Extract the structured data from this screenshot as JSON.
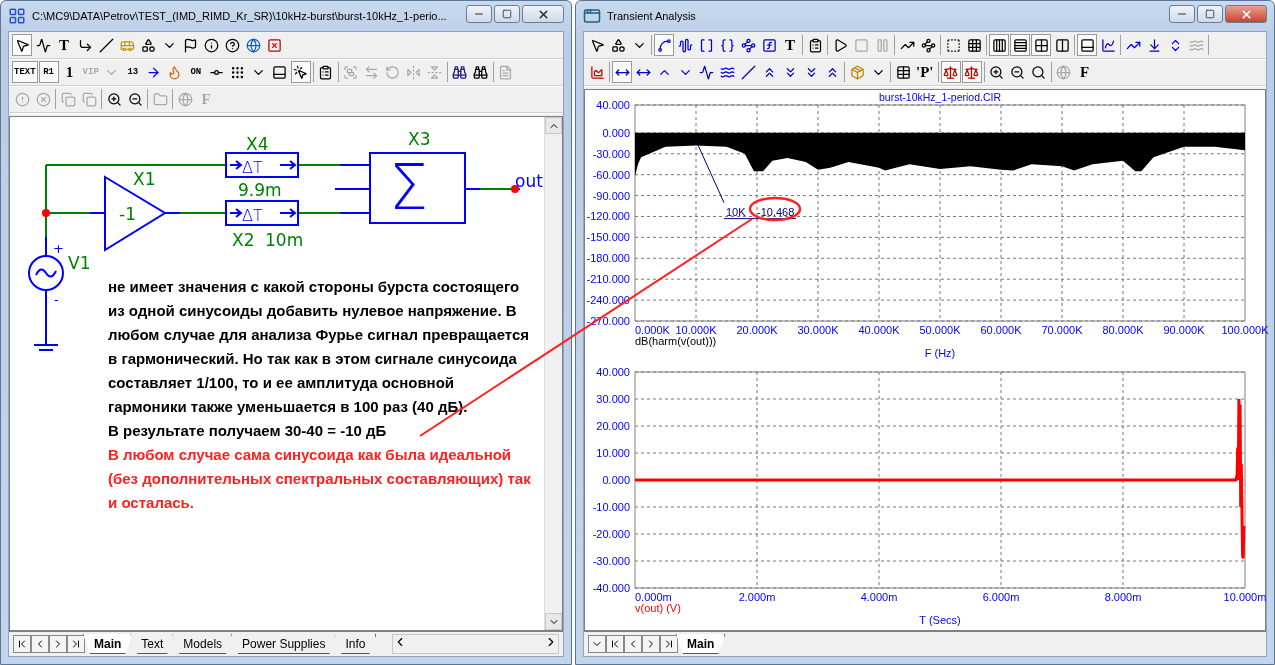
{
  "schematic_window": {
    "title": "C:\\MC9\\DATA\\Petrov\\TEST_(IMD_RIMD_Kr_SR)\\10kHz-burst\\burst-10kHz_1-perio...",
    "active": false,
    "toolbars": [
      [
        {
          "kind": "icon",
          "selected": true,
          "disabled": false
        },
        {
          "kind": "icon",
          "selected": false,
          "disabled": false
        },
        {
          "kind": "text",
          "label": "T",
          "selected": false,
          "disabled": false
        },
        {
          "kind": "icon",
          "selected": false,
          "disabled": false
        },
        {
          "kind": "icon",
          "selected": false,
          "disabled": false
        },
        {
          "kind": "icon",
          "selected": false,
          "disabled": false
        },
        {
          "kind": "icon",
          "selected": false,
          "disabled": false
        },
        {
          "kind": "icon",
          "selected": false,
          "disabled": false
        },
        {
          "kind": "icon",
          "selected": false,
          "disabled": false
        },
        {
          "kind": "icon",
          "selected": false,
          "disabled": false
        },
        {
          "kind": "icon",
          "selected": false,
          "disabled": false
        },
        {
          "kind": "icon",
          "selected": false,
          "disabled": false
        },
        {
          "kind": "icon",
          "selected": false,
          "disabled": false
        }
      ],
      [
        {
          "kind": "text",
          "label": "TEXT",
          "selected": true,
          "disabled": false
        },
        {
          "kind": "text",
          "label": "R1",
          "selected": true,
          "disabled": false
        },
        {
          "kind": "text",
          "label": "1",
          "selected": false,
          "disabled": false
        },
        {
          "kind": "text",
          "label": "VIP",
          "selected": false,
          "disabled": true
        },
        {
          "kind": "icon",
          "selected": false,
          "disabled": true
        },
        {
          "kind": "text",
          "label": "13",
          "selected": false,
          "disabled": false
        },
        {
          "kind": "icon",
          "selected": false,
          "disabled": false
        },
        {
          "kind": "icon",
          "selected": false,
          "disabled": false
        },
        {
          "kind": "text",
          "label": "ON",
          "selected": false,
          "disabled": false
        },
        {
          "kind": "icon",
          "selected": false,
          "disabled": false
        },
        {
          "kind": "icon",
          "selected": false,
          "disabled": false
        },
        {
          "kind": "icon",
          "selected": false,
          "disabled": false
        },
        {
          "kind": "icon",
          "selected": false,
          "disabled": false
        },
        {
          "kind": "icon",
          "selected": true,
          "disabled": false
        },
        {
          "kind": "separator"
        },
        {
          "kind": "icon",
          "selected": false,
          "disabled": false
        },
        {
          "kind": "separator"
        },
        {
          "kind": "icon",
          "selected": false,
          "disabled": true
        },
        {
          "kind": "icon",
          "selected": false,
          "disabled": true
        },
        {
          "kind": "icon",
          "selected": false,
          "disabled": true
        },
        {
          "kind": "icon",
          "selected": false,
          "disabled": true
        },
        {
          "kind": "icon",
          "selected": false,
          "disabled": true
        },
        {
          "kind": "separator"
        },
        {
          "kind": "icon",
          "selected": false,
          "disabled": false
        },
        {
          "kind": "icon",
          "selected": false,
          "disabled": false
        },
        {
          "kind": "separator"
        },
        {
          "kind": "icon",
          "selected": false,
          "disabled": true
        }
      ],
      [
        {
          "kind": "icon",
          "selected": false,
          "disabled": true
        },
        {
          "kind": "icon",
          "selected": false,
          "disabled": true
        },
        {
          "kind": "separator"
        },
        {
          "kind": "icon",
          "selected": false,
          "disabled": true
        },
        {
          "kind": "icon",
          "selected": false,
          "disabled": true
        },
        {
          "kind": "separator"
        },
        {
          "kind": "icon",
          "selected": false,
          "disabled": false
        },
        {
          "kind": "icon",
          "selected": false,
          "disabled": false
        },
        {
          "kind": "separator"
        },
        {
          "kind": "icon",
          "selected": false,
          "disabled": true
        },
        {
          "kind": "separator"
        },
        {
          "kind": "icon",
          "selected": false,
          "disabled": true
        },
        {
          "kind": "text",
          "label": "F",
          "selected": false,
          "disabled": true
        }
      ]
    ],
    "schematic": {
      "labels": [
        {
          "kind": "component",
          "text": "X4"
        },
        {
          "kind": "component",
          "text": "9.9m"
        },
        {
          "kind": "component",
          "text": "X1"
        },
        {
          "kind": "component",
          "text": "-1"
        },
        {
          "kind": "component",
          "text": "X2"
        },
        {
          "kind": "component",
          "text": "10m"
        },
        {
          "kind": "component",
          "text": "X3"
        },
        {
          "kind": "node",
          "text": "out"
        },
        {
          "kind": "component",
          "text": "V1"
        },
        {
          "kind": "pin",
          "text": "+"
        },
        {
          "kind": "pin",
          "text": "-"
        },
        {
          "kind": "symbol",
          "text": "ΔT"
        },
        {
          "kind": "symbol",
          "text": "ΔT"
        },
        {
          "kind": "symbol",
          "text": "Σ"
        }
      ]
    },
    "notes": [
      {
        "kind": "plain",
        "text": "не имеет значения с какой стороны бурста состоящего из одной синусоиды добавить нулевое напряжение. В любом случае для анализа Фурье сигнал превращается в гармонический. Но так как в этом сигнале синусоида составляет 1/100, то и ее амплитуда основной гармоники также уменьшается в 100 раз (40 дБ)."
      },
      {
        "kind": "plain",
        "text": "В результате получаем 30-40 = -10 дБ"
      },
      {
        "kind": "highlight",
        "text": "В любом случае сама синусоида как была идеальной (без дополнительных спектральных составляющих) так и осталась."
      }
    ],
    "tabs": [
      {
        "label": "Main",
        "selected": true
      },
      {
        "label": "Text",
        "selected": false
      },
      {
        "label": "Models",
        "selected": false
      },
      {
        "label": "Power Supplies",
        "selected": false
      },
      {
        "label": "Info",
        "selected": false
      }
    ]
  },
  "analysis_window": {
    "title": "Transient Analysis",
    "active": true,
    "toolbars": [
      [
        {
          "kind": "icon",
          "selected": false,
          "disabled": false
        },
        {
          "kind": "icon",
          "selected": false,
          "disabled": false
        },
        {
          "kind": "icon",
          "selected": false,
          "disabled": false
        },
        {
          "kind": "separator"
        },
        {
          "kind": "icon",
          "selected": true,
          "disabled": false
        },
        {
          "kind": "icon",
          "selected": false,
          "disabled": false
        },
        {
          "kind": "icon",
          "selected": false,
          "disabled": false
        },
        {
          "kind": "icon",
          "selected": false,
          "disabled": false
        },
        {
          "kind": "icon",
          "selected": false,
          "disabled": false
        },
        {
          "kind": "icon",
          "selected": false,
          "disabled": false
        },
        {
          "kind": "text",
          "label": "T",
          "selected": false,
          "disabled": false
        },
        {
          "kind": "separator"
        },
        {
          "kind": "icon",
          "selected": false,
          "disabled": false
        },
        {
          "kind": "separator"
        },
        {
          "kind": "icon",
          "selected": false,
          "disabled": false
        },
        {
          "kind": "icon",
          "selected": false,
          "disabled": true
        },
        {
          "kind": "icon",
          "selected": false,
          "disabled": true
        },
        {
          "kind": "separator"
        },
        {
          "kind": "icon",
          "selected": false,
          "disabled": false
        },
        {
          "kind": "icon",
          "selected": false,
          "disabled": false
        },
        {
          "kind": "separator"
        },
        {
          "kind": "icon",
          "selected": false,
          "disabled": false
        },
        {
          "kind": "icon",
          "selected": false,
          "disabled": false
        },
        {
          "kind": "separator"
        },
        {
          "kind": "icon",
          "selected": true,
          "disabled": false
        },
        {
          "kind": "icon",
          "selected": true,
          "disabled": false
        },
        {
          "kind": "icon",
          "selected": true,
          "disabled": false
        },
        {
          "kind": "icon",
          "selected": false,
          "disabled": false
        },
        {
          "kind": "separator"
        },
        {
          "kind": "icon",
          "selected": true,
          "disabled": false
        },
        {
          "kind": "icon",
          "selected": false,
          "disabled": false
        },
        {
          "kind": "separator"
        },
        {
          "kind": "icon",
          "selected": false,
          "disabled": false
        },
        {
          "kind": "icon",
          "selected": false,
          "disabled": false
        },
        {
          "kind": "icon",
          "selected": false,
          "disabled": false
        },
        {
          "kind": "icon",
          "selected": false,
          "disabled": true
        },
        {
          "kind": "separator"
        }
      ],
      [
        {
          "kind": "icon",
          "selected": false,
          "disabled": false
        },
        {
          "kind": "separator"
        },
        {
          "kind": "icon",
          "selected": true,
          "disabled": false
        },
        {
          "kind": "icon",
          "selected": false,
          "disabled": false
        },
        {
          "kind": "icon",
          "selected": false,
          "disabled": false
        },
        {
          "kind": "icon",
          "selected": false,
          "disabled": false
        },
        {
          "kind": "icon",
          "selected": false,
          "disabled": false
        },
        {
          "kind": "icon",
          "selected": false,
          "disabled": false
        },
        {
          "kind": "icon",
          "selected": false,
          "disabled": false
        },
        {
          "kind": "icon",
          "selected": false,
          "disabled": false
        },
        {
          "kind": "icon",
          "selected": false,
          "disabled": false
        },
        {
          "kind": "icon",
          "selected": false,
          "disabled": false
        },
        {
          "kind": "icon",
          "selected": false,
          "disabled": false
        },
        {
          "kind": "separator"
        },
        {
          "kind": "icon",
          "selected": false,
          "disabled": false
        },
        {
          "kind": "icon",
          "selected": false,
          "disabled": false
        },
        {
          "kind": "separator"
        },
        {
          "kind": "icon",
          "selected": false,
          "disabled": false
        },
        {
          "kind": "text",
          "label": "'P'",
          "selected": false,
          "disabled": false
        },
        {
          "kind": "separator"
        },
        {
          "kind": "icon",
          "selected": true,
          "disabled": false
        },
        {
          "kind": "icon",
          "selected": true,
          "disabled": false
        },
        {
          "kind": "separator"
        },
        {
          "kind": "icon",
          "selected": false,
          "disabled": false
        },
        {
          "kind": "icon",
          "selected": false,
          "disabled": false
        },
        {
          "kind": "icon",
          "selected": false,
          "disabled": false
        },
        {
          "kind": "separator"
        },
        {
          "kind": "icon",
          "selected": false,
          "disabled": true
        },
        {
          "kind": "text",
          "label": "F",
          "selected": false,
          "disabled": false
        }
      ]
    ],
    "spectrum_plot": {
      "title": "burst-10kHz_1-period.CIR",
      "chart_data": {
        "type": "area",
        "xlabel": "F (Hz)",
        "x": [
          0,
          500,
          1000,
          5000,
          10000,
          15000,
          18000,
          19500,
          21000,
          22500,
          25000,
          28000,
          30000,
          32000,
          35000,
          40000,
          41000,
          45000,
          50000,
          55000,
          60000,
          62000,
          65000,
          70000,
          72000,
          75000,
          80000,
          82000,
          83000,
          85000,
          90000,
          95000,
          100000
        ],
        "series": [
          {
            "name": "dB(harm(v(out)))",
            "color": "#000000",
            "values": [
              -62,
              -45,
              -35,
              -20,
              -18,
              -20,
              -30,
              -55,
              -55,
              -40,
              -36,
              -42,
              -53,
              -50,
              -42,
              -50,
              -54,
              -45,
              -52,
              -48,
              -53,
              -54,
              -45,
              -48,
              -54,
              -45,
              -40,
              -55,
              -55,
              -35,
              -20,
              -20,
              -25
            ]
          }
        ],
        "xlim": [
          0,
          100000
        ],
        "ylim": [
          -270,
          40
        ],
        "xticks": [
          {
            "value": 0,
            "label": "0.000K"
          },
          {
            "value": 10000,
            "label": "10.000K"
          },
          {
            "value": 20000,
            "label": "20.000K"
          },
          {
            "value": 30000,
            "label": "30.000K"
          },
          {
            "value": 40000,
            "label": "40.000K"
          },
          {
            "value": 50000,
            "label": "50.000K"
          },
          {
            "value": 60000,
            "label": "60.000K"
          },
          {
            "value": 70000,
            "label": "70.000K"
          },
          {
            "value": 80000,
            "label": "80.000K"
          },
          {
            "value": 90000,
            "label": "90.000K"
          },
          {
            "value": 100000,
            "label": "100.000K"
          }
        ],
        "yticks": [
          {
            "value": 40,
            "label": "40.000"
          },
          {
            "value": 0,
            "label": "0.000"
          },
          {
            "value": -30,
            "label": "-30.000"
          },
          {
            "value": -60,
            "label": "-60.000"
          },
          {
            "value": -90,
            "label": "-90.000"
          },
          {
            "value": -120,
            "label": "-120.000"
          },
          {
            "value": -150,
            "label": "-150.000"
          },
          {
            "value": -180,
            "label": "-180.000"
          },
          {
            "value": -210,
            "label": "-210.000"
          },
          {
            "value": -240,
            "label": "-240.000"
          },
          {
            "value": -270,
            "label": "-270.000"
          }
        ],
        "grid": true,
        "annotations": [
          "10K",
          "-10.468"
        ]
      }
    },
    "time_plot": {
      "chart_data": {
        "type": "line",
        "xlabel": "T (Secs)",
        "x": [
          0,
          9.85,
          9.87,
          9.88,
          9.89,
          9.9,
          9.91,
          9.92,
          9.93,
          9.94,
          9.95,
          9.96,
          9.97,
          9.98
        ],
        "series": [
          {
            "name": "v(out) (V)",
            "color": "#ff0000",
            "values": [
              0,
              0,
              2,
              12,
              0,
              30,
              0,
              28,
              -10,
              6,
              -10,
              -28,
              -29,
              -17
            ]
          }
        ],
        "xlim": [
          0,
          10
        ],
        "ylim": [
          -40,
          40
        ],
        "grid": true,
        "xticks": [
          {
            "value": 0,
            "label": "0.000m"
          },
          {
            "value": 2,
            "label": "2.000m"
          },
          {
            "value": 4,
            "label": "4.000m"
          },
          {
            "value": 6,
            "label": "6.000m"
          },
          {
            "value": 8,
            "label": "8.000m"
          },
          {
            "value": 10,
            "label": "10.000m"
          }
        ],
        "yticks": [
          {
            "value": 40,
            "label": "40.000"
          },
          {
            "value": 30,
            "label": "30.000"
          },
          {
            "value": 20,
            "label": "20.000"
          },
          {
            "value": 10,
            "label": "10.000"
          },
          {
            "value": 0,
            "label": "0.000"
          },
          {
            "value": -10,
            "label": "-10.000"
          },
          {
            "value": -20,
            "label": "-20.000"
          },
          {
            "value": -30,
            "label": "-30.000"
          },
          {
            "value": -40,
            "label": "-40.000"
          }
        ]
      }
    },
    "tabs": [
      {
        "label": "Main",
        "selected": true
      }
    ]
  }
}
